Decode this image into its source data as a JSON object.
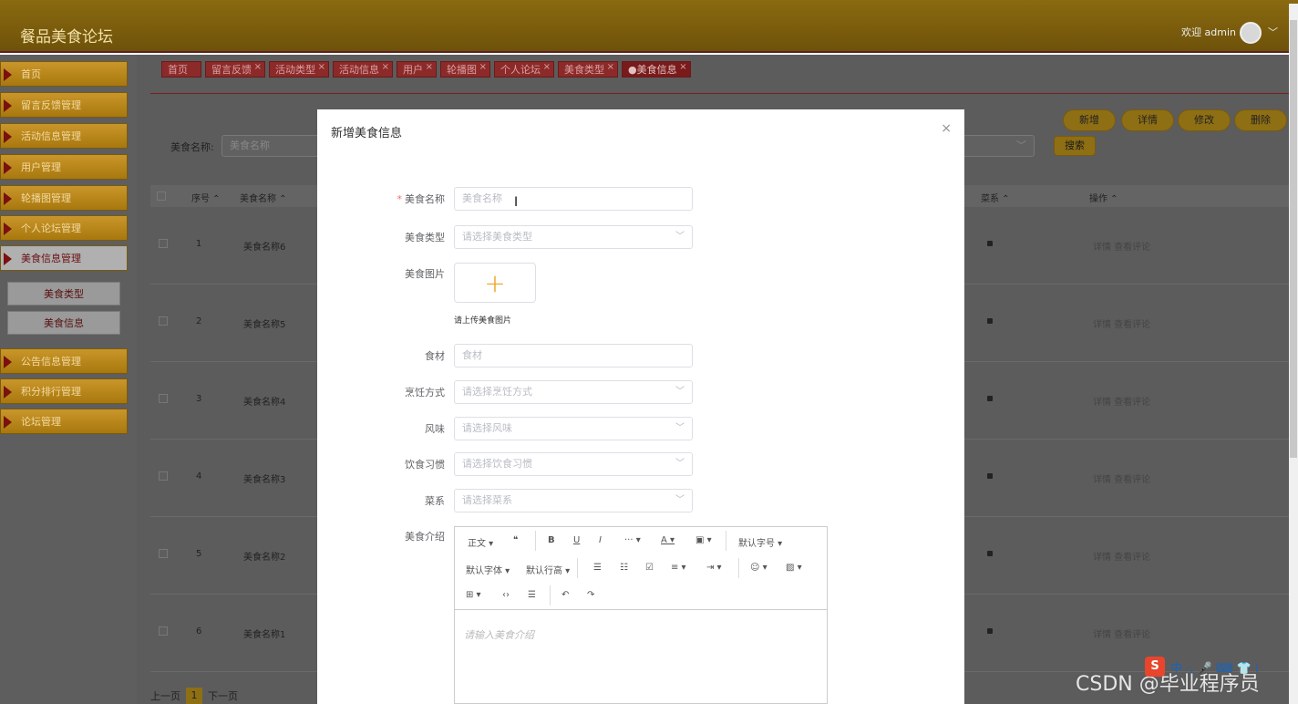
{
  "app": {
    "title": "餐品美食论坛",
    "welcome": "欢迎 admin",
    "user_chevron": "﹀"
  },
  "sidebar": {
    "items": [
      "首页",
      "留言反馈管理",
      "活动信息管理",
      "用户管理",
      "轮播图管理",
      "个人论坛管理",
      "美食信息管理",
      "公告信息管理",
      "积分排行管理",
      "论坛管理"
    ],
    "sub_items": [
      "美食类型",
      "美食信息"
    ]
  },
  "tabs": [
    "首页",
    "留言反馈",
    "活动类型",
    "活动信息",
    "用户",
    "轮播图",
    "个人论坛",
    "美食类型",
    "●美食信息"
  ],
  "tab_close": "×",
  "search": {
    "label": "美食名称:",
    "placeholder": "美食名称",
    "select_chevron": "﹀",
    "button": "搜索"
  },
  "actions": {
    "add": "新增",
    "detail": "详情",
    "edit": "修改",
    "delete": "删除"
  },
  "table": {
    "headers": {
      "index": "序号 ⌃",
      "name": "美食名称 ⌃",
      "cuisine": "菜系 ⌃",
      "ops": "操作 ⌃"
    },
    "rows": [
      {
        "index": "1",
        "name": "美食名称6",
        "ops": "详情 查看评论"
      },
      {
        "index": "2",
        "name": "美食名称5",
        "ops": "详情 查看评论"
      },
      {
        "index": "3",
        "name": "美食名称4",
        "ops": "详情 查看评论"
      },
      {
        "index": "4",
        "name": "美食名称3",
        "ops": "详情 查看评论"
      },
      {
        "index": "5",
        "name": "美食名称2",
        "ops": "详情 查看评论"
      },
      {
        "index": "6",
        "name": "美食名称1",
        "ops": "详情 查看评论"
      }
    ]
  },
  "pager": {
    "prev": "上一页",
    "page": "1",
    "next": "下一页"
  },
  "modal": {
    "title": "新增美食信息",
    "close": "×",
    "required_mark": "*",
    "fields": {
      "name": {
        "label": "美食名称",
        "placeholder": "美食名称"
      },
      "type": {
        "label": "美食类型",
        "placeholder": "请选择美食类型"
      },
      "image": {
        "label": "美食图片",
        "tip": "请上传美食图片",
        "plus": "+"
      },
      "ingredients": {
        "label": "食材",
        "placeholder": "食材"
      },
      "cooking": {
        "label": "烹饪方式",
        "placeholder": "请选择烹饪方式"
      },
      "flavor": {
        "label": "风味",
        "placeholder": "请选择风味"
      },
      "habit": {
        "label": "饮食习惯",
        "placeholder": "请选择饮食习惯"
      },
      "cuisine": {
        "label": "菜系",
        "placeholder": "请选择菜系"
      },
      "intro": {
        "label": "美食介绍",
        "placeholder": "请输入美食介绍"
      }
    },
    "select_chevron": "﹀",
    "editor_toolbar": {
      "paragraph": "正文 ▾",
      "quote": "❝",
      "bold": "B",
      "underline": "U",
      "italic": "I",
      "more": "··· ▾",
      "font_color": "A ▾",
      "bg_color": "▣ ▾",
      "font_size": "默认字号 ▾",
      "font_family": "默认字体 ▾",
      "line_height": "默认行高 ▾",
      "bullet_list": "☰",
      "ordered_list": "☷",
      "todo": "☑",
      "align": "≡ ▾",
      "indent": "⇥ ▾",
      "emoji": "☺ ▾",
      "image": "▨ ▾",
      "table": "⊞ ▾",
      "code": "‹›",
      "divider": "☰",
      "undo": "↶",
      "redo": "↷"
    }
  },
  "cursor": "I",
  "overlay": {
    "watermark": "CSDN @毕业程序员",
    "ime_logo": "S",
    "ime_text": "中 ·, 🎤 ⌨ 👕 ⁞"
  },
  "colors": {
    "topbar": "#7d5f0e",
    "menu": "#b8881c",
    "tab": "#8c2a2a",
    "asterisk": "#f56c6c",
    "plus": "#f0a020"
  }
}
